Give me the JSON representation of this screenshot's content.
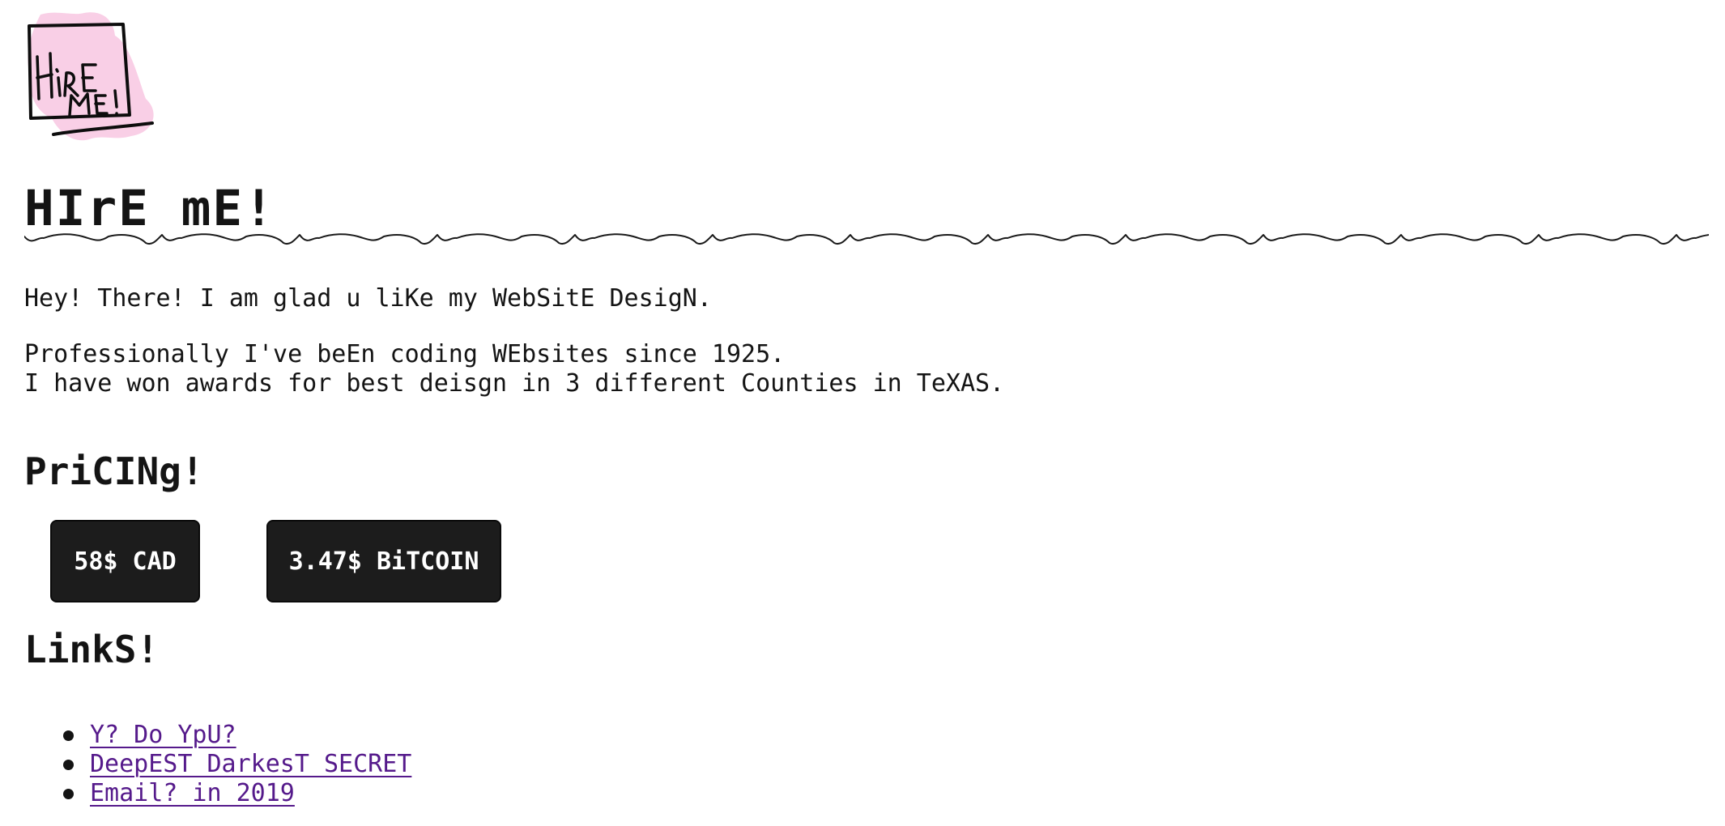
{
  "logo": {
    "icon": "hire-me-logo",
    "text_line1": "HiRE",
    "text_line2": "ME!",
    "highlight_color": "#f9cfe6"
  },
  "header": {
    "title": "HIrE mE!"
  },
  "intro": {
    "greeting": "Hey! There! I am glad u liKe my WebSitE DesigN.",
    "line1": "Professionally I've beEn coding WEbsites since 1925.",
    "line2": "I have won awards for best deisgn in 3 different Counties in TeXAS."
  },
  "pricing": {
    "heading": "PriCINg!",
    "options": [
      {
        "label": "58$ CAD"
      },
      {
        "label": "3.47$ BiTCOIN"
      }
    ],
    "button_color": "#1c1c1c"
  },
  "links": {
    "heading": "LinkS!",
    "items": [
      {
        "label": "Y? Do YpU?"
      },
      {
        "label": "DeepEST DarkesT SECRET"
      },
      {
        "label": "Email? in 2019"
      }
    ],
    "link_color": "#551a8b"
  }
}
